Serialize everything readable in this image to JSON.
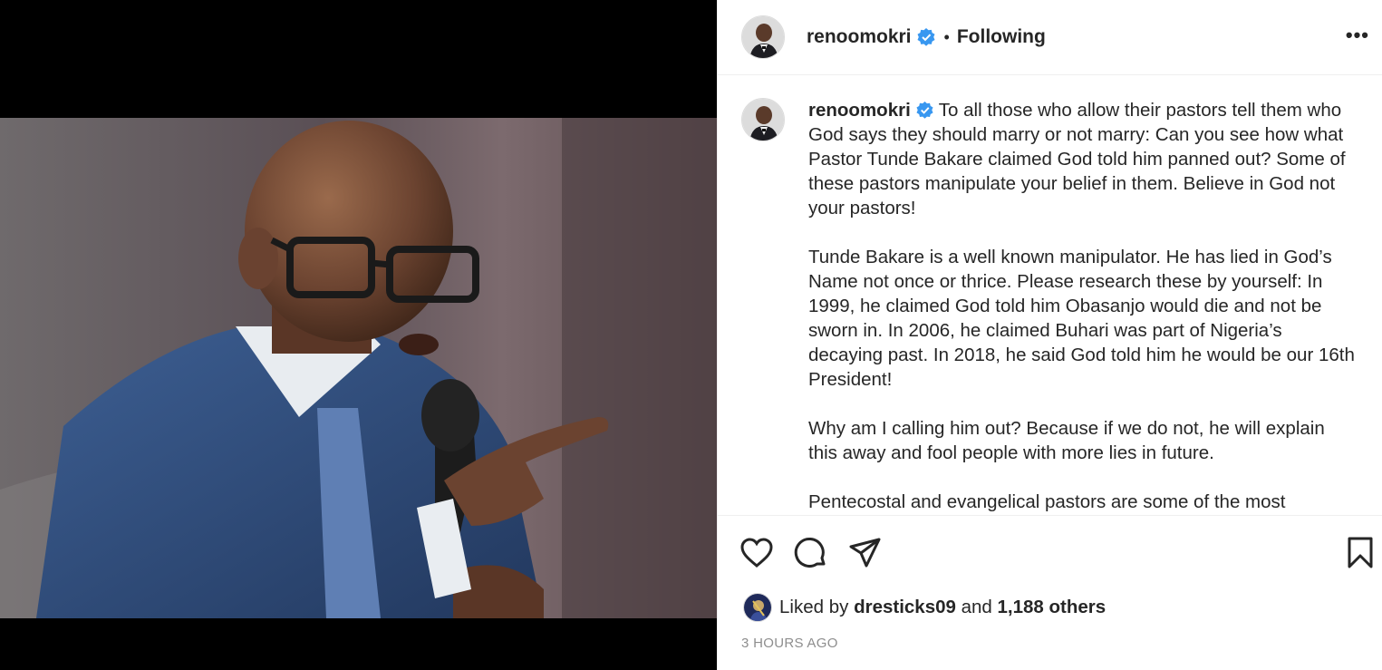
{
  "post": {
    "username": "renoomokri",
    "verified": true,
    "follow_state": "Following",
    "separator": "•",
    "more_label": "•••"
  },
  "caption": {
    "username": "renoomokri",
    "paragraphs": [
      "To all those who allow their pastors tell them who God says they should marry or not marry: Can you see how what Pastor Tunde Bakare claimed God told him panned out? Some of these pastors manipulate your belief in them. Believe in God not your pastors!",
      "Tunde Bakare is a well known manipulator. He has lied in God’s Name not once or thrice. Please research these by yourself: In 1999, he claimed God told him Obasanjo would die and not be sworn in. In 2006, he claimed Buhari was part of Nigeria’s decaying past. In 2018, he said God told him he would be our 16th President!",
      "Why am I calling him out? Because if we do not, he will explain this away and fool people with more lies in future.",
      "Pentecostal and evangelical pastors are some of the most"
    ]
  },
  "actions": {
    "icons": [
      "heart-icon",
      "comment-icon",
      "share-icon",
      "bookmark-icon"
    ]
  },
  "likes": {
    "prefix": "Liked by",
    "first_liker": "dresticks09",
    "conjunction": "and",
    "others": "1,188 others"
  },
  "timestamp": "3 HOURS AGO",
  "colors": {
    "verified": "#3897f0",
    "text": "#262626",
    "muted": "#8e8e8e",
    "border": "#efefef",
    "media_bg": "#000000"
  }
}
